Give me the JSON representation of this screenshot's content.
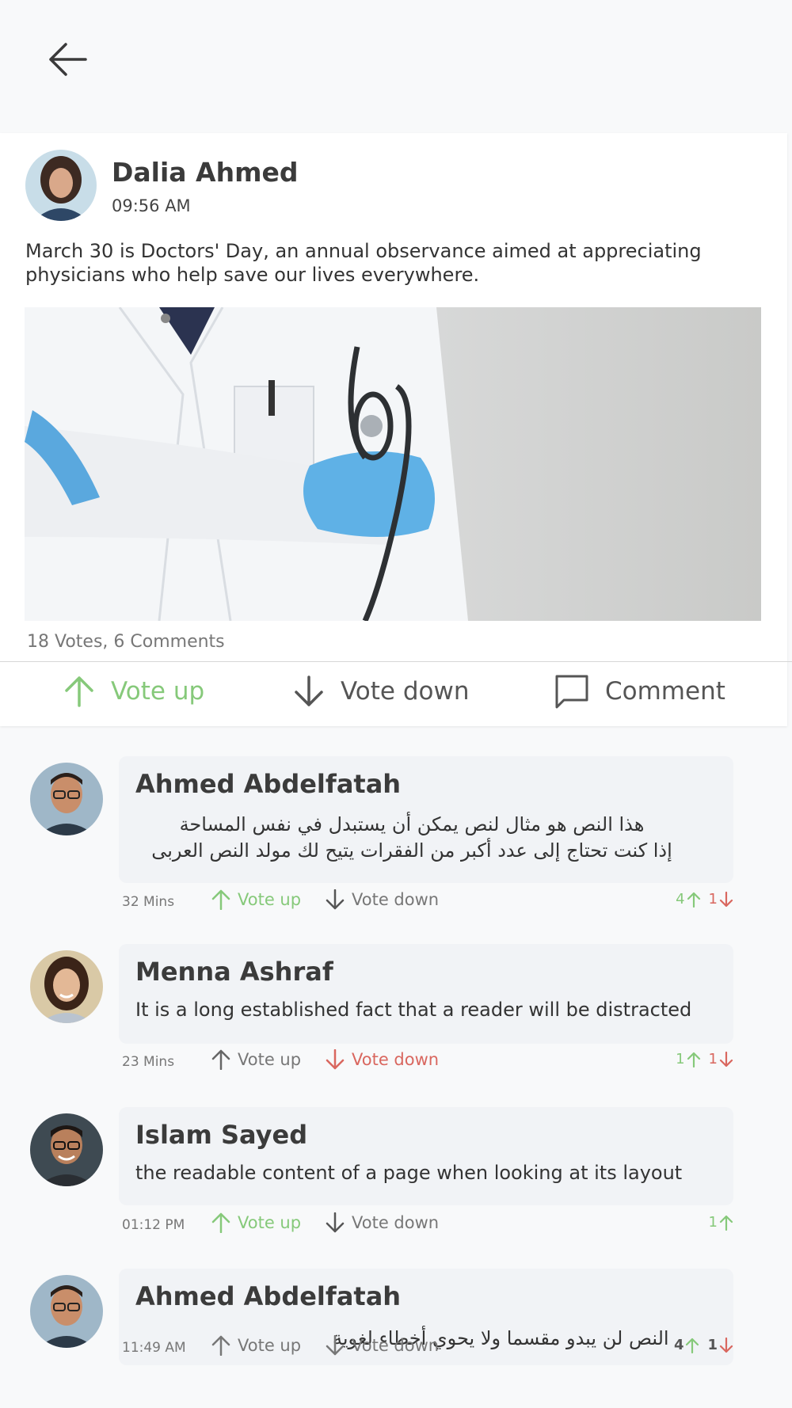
{
  "header": {
    "back_icon": "arrow-left-icon"
  },
  "post": {
    "author": "Dalia Ahmed",
    "time": "09:56 AM",
    "text": "March 30 is Doctors' Day, an annual observance aimed at appreciating physicians who help save our lives everywhere.",
    "stats": "18 Votes, 6 Comments",
    "actions": {
      "vote_up": "Vote up",
      "vote_down": "Vote down",
      "comment": "Comment"
    }
  },
  "comments": [
    {
      "author": "Ahmed Abdelfatah",
      "text_lines": [
        "هذا النص هو مثال لنص يمكن أن يستبدل في نفس المساحة",
        "إذا كنت تحتاج إلى عدد أكبر من الفقرات يتيح لك مولد النص العربى"
      ],
      "time": "32 Mins",
      "vote_up": "Vote up",
      "vote_down": "Vote down",
      "up_count": "4",
      "down_count": "1",
      "state": "up"
    },
    {
      "author": "Menna Ashraf",
      "text": "It is a long established fact that a reader will be distracted",
      "time": "23 Mins",
      "vote_up": "Vote up",
      "vote_down": "Vote down",
      "up_count": "1",
      "down_count": "1",
      "state": "down"
    },
    {
      "author": "Islam Sayed",
      "text": "the readable content of a page when looking at its layout",
      "time": "01:12 PM",
      "vote_up": "Vote up",
      "vote_down": "Vote down",
      "up_count": "1",
      "state": "up"
    },
    {
      "author": "Ahmed Abdelfatah",
      "text": "النص لن يبدو مقسما ولا يحوي أخطاء لغوية",
      "time": "11:49 AM",
      "vote_up": "Vote up",
      "vote_down": "Vote down",
      "up_count": "4",
      "down_count": "1",
      "state": "none"
    }
  ],
  "colors": {
    "up": "#86c97a",
    "down": "#d9675f",
    "bubble": "#f1f3f6"
  }
}
